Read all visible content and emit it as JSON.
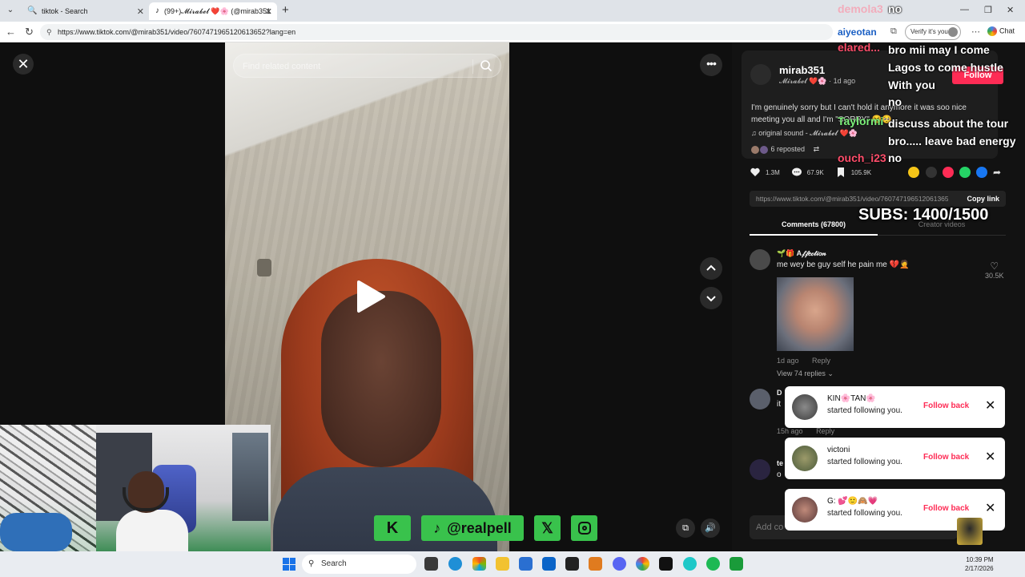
{
  "browser": {
    "tabs": [
      {
        "title": "tiktok - Search",
        "icon": "search-icon"
      },
      {
        "title": "(99+)𝓜𝓲𝓻𝓪𝓫𝓮𝓵 ❤️🌸 (@mirab351",
        "icon": "tiktok-icon"
      }
    ],
    "url": "https://www.tiktok.com/@mirab351/video/7607471965120613652?lang=en",
    "profile_name": "aiyeotan",
    "verify_label": "Verify it's you",
    "chat_label": "Chat"
  },
  "video": {
    "search_placeholder": "Find related content"
  },
  "social_bar": {
    "tiktok_handle": "@realpell"
  },
  "post": {
    "author": "mirab351",
    "display_name": "𝓜𝓲𝓻𝓪𝓫𝓮𝓵 ❤️🌸",
    "time": "1d ago",
    "follow_label": "Follow",
    "caption": "I'm genuinely sorry but I can't hold it anymore it was soo nice meeting you all and I'm \"SORRY\" 😢🥺",
    "sound": "original sound - 𝓜𝓲𝓻𝓪𝓫𝓮𝓵 ❤️🌸",
    "reposted": "6 reposted",
    "stats": {
      "likes": "1.3M",
      "comments": "67.9K",
      "saves": "105.9K"
    },
    "link": "https://www.tiktok.com/@mirab351/video/7607471965120613652...",
    "copy_link_label": "Copy link"
  },
  "panel_tabs": [
    "Comments (67800)",
    "Creator videos"
  ],
  "comments": [
    {
      "name": "🌱🎁 A𝒻𝒻𝑒𝒸𝓉𝒾𝑜𝓃",
      "text": "me wey be guy self he pain me 💔🤦",
      "time": "1d ago",
      "reply_label": "Reply",
      "likes": "30.5K",
      "view_replies": "View 74 replies"
    },
    {
      "name": "D",
      "text": "it",
      "time": "15h ago",
      "reply_label": "Reply"
    },
    {
      "name": "te",
      "text": "o"
    }
  ],
  "add_comment_placeholder": "Add co",
  "stream_chat": [
    {
      "user": "demola3",
      "message": "no",
      "color": "#ff8aa0"
    },
    {
      "user": "elared...",
      "message": "bro mii may I come Lagos to come hustle With you",
      "color": "#ff4d6a"
    },
    {
      "user": "",
      "message": "no",
      "color": "#ffffff"
    },
    {
      "user": "Taylormi",
      "message": "discuss about the tour bro..... leave bad energy",
      "color": "#7cf07a"
    },
    {
      "user": "ouch_i23",
      "message": "no",
      "color": "#ff4d6a"
    }
  ],
  "subs_goal": "SUBS: 1400/1500",
  "notifications": [
    {
      "name": "KIN🌸TAN🌸",
      "text": "started following you.",
      "action": "Follow back"
    },
    {
      "name": "victoni",
      "text": "started following you.",
      "action": "Follow back"
    },
    {
      "name": "G: 💕🙂🙈💗",
      "text": "started following you.",
      "action": "Follow back"
    }
  ],
  "taskbar": {
    "search_label": "Search",
    "time": "10:39 PM",
    "date": "2/17/2026"
  },
  "colors": {
    "tiktok_red": "#fe2c55",
    "social_green": "#39c24c",
    "panel_bg": "#121212"
  }
}
